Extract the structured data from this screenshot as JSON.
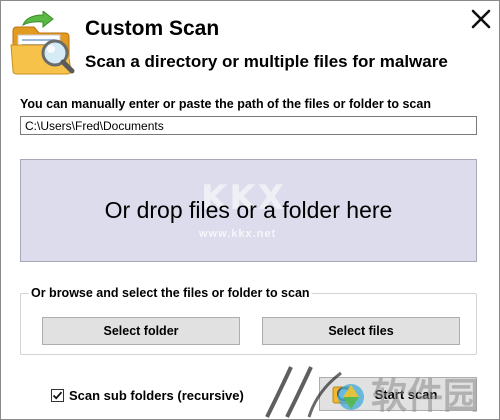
{
  "header": {
    "title": "Custom Scan",
    "subtitle": "Scan a directory or multiple files for malware",
    "icon": "folder-search-icon"
  },
  "path": {
    "label": "You can manually enter or paste the path of the files or folder to scan",
    "value": "C:\\Users\\Fred\\Documents"
  },
  "drop_zone": {
    "text": "Or drop files or a folder here",
    "watermark_url": "www.kkx.net"
  },
  "browse": {
    "legend": "Or browse and select the files or folder to scan",
    "select_folder_label": "Select folder",
    "select_files_label": "Select files"
  },
  "options": {
    "scan_subfolders_label": "Scan sub folders (recursive)",
    "scan_subfolders_checked": true
  },
  "start": {
    "label": "Start scan"
  },
  "watermark": {
    "text": "软件园"
  },
  "colors": {
    "drop_zone_bg": "#dcdcec",
    "button_bg": "#e1e1e1",
    "accent_green": "#4caf3a",
    "folder_yellow": "#f2b630"
  }
}
